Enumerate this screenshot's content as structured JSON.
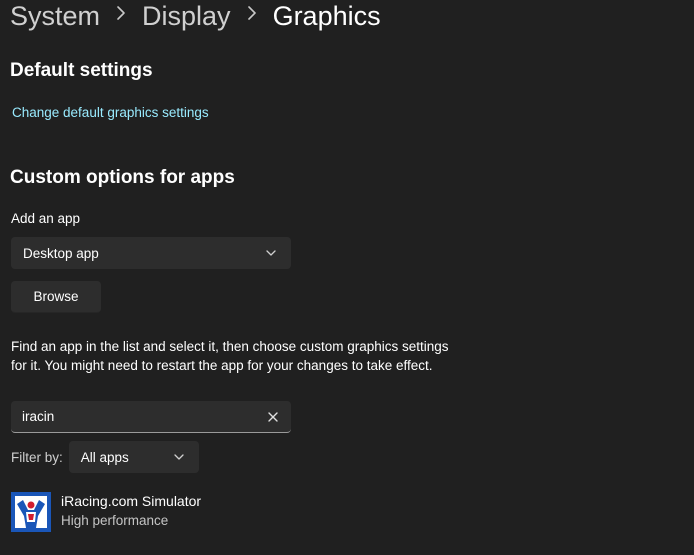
{
  "breadcrumb": {
    "items": [
      "System",
      "Display"
    ],
    "current": "Graphics",
    "separator_icon": "chevron-right-icon"
  },
  "default_settings": {
    "title": "Default settings",
    "link": "Change default graphics settings"
  },
  "custom_options": {
    "title": "Custom options for apps",
    "add_app_label": "Add an app",
    "app_type_dropdown": {
      "selected": "Desktop app"
    },
    "browse_button": "Browse",
    "description": "Find an app in the list and select it, then choose custom graphics settings for it. You might need to restart the app for your changes to take effect.",
    "search": {
      "value": "iracin"
    },
    "filter": {
      "label": "Filter by:",
      "selected": "All apps"
    },
    "apps": [
      {
        "name": "iRacing.com Simulator",
        "setting": "High performance",
        "icon": "iracing-app-icon"
      }
    ]
  },
  "colors": {
    "background": "#202020",
    "control": "#2d2d2d",
    "link": "#99ebff",
    "text": "#ffffff",
    "secondary_text": "#c5c5c5"
  }
}
